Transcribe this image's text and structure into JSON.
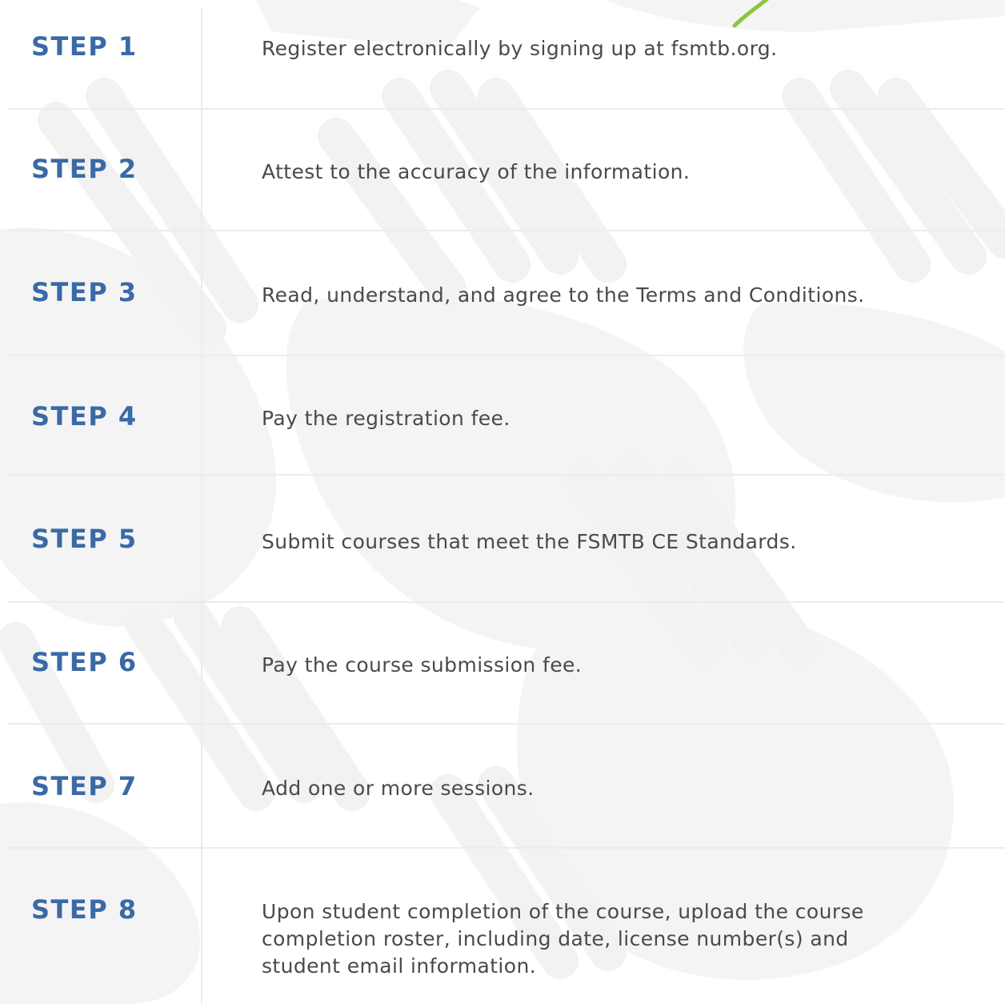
{
  "colors": {
    "step_label": "#3a6aa6",
    "body_text": "#4a4a4a",
    "divider": "#ececec",
    "background_art": "#f3f3f3",
    "accent_green": "#8cc63f"
  },
  "steps": [
    {
      "label": "STEP 1",
      "text": "Register electronically by signing up at fsmtb.org."
    },
    {
      "label": "STEP 2",
      "text": "Attest to the accuracy of the information."
    },
    {
      "label": "STEP 3",
      "text": "Read, understand, and agree to the Terms and Conditions."
    },
    {
      "label": "STEP 4",
      "text": "Pay the registration fee."
    },
    {
      "label": "STEP 5",
      "text": "Submit courses that meet the FSMTB CE Standards."
    },
    {
      "label": "STEP 6",
      "text": "Pay the course submission fee."
    },
    {
      "label": "STEP 7",
      "text": "Add one or more sessions."
    },
    {
      "label": "STEP 8",
      "text": "Upon student completion of the course, upload the course completion roster, including date, license number(s) and student email information.",
      "lines": [
        "Upon student completion of the course, upload the course",
        "completion roster, including date, license number(s) and",
        "student email information."
      ]
    }
  ]
}
